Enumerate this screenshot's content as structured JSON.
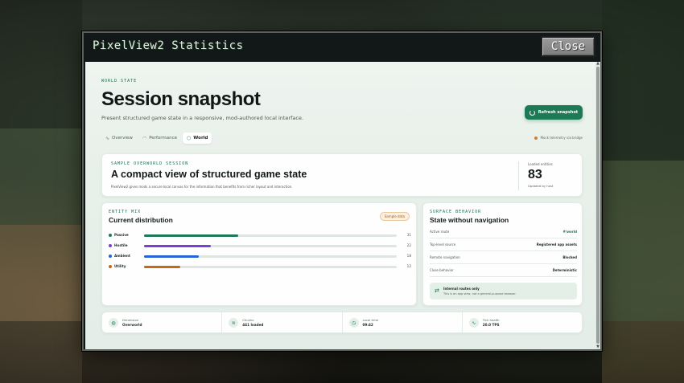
{
  "window": {
    "title": "PixelView2 Statistics",
    "close_label": "Close"
  },
  "header": {
    "eyebrow": "WORLD STATE",
    "title": "Session snapshot",
    "subtitle": "Present structured game state in a responsive, mod-authored local interface.",
    "refresh_label": "Refresh snapshot"
  },
  "tabs": [
    {
      "label": "Overview",
      "icon": "activity-icon"
    },
    {
      "label": "Performance",
      "icon": "gauge-icon"
    },
    {
      "label": "World",
      "icon": "cube-icon",
      "active": true
    }
  ],
  "telemetry_note": "Mock telemetry via bridge",
  "overview": {
    "eyebrow": "SAMPLE OVERWORLD SESSION",
    "title": "A compact view of structured game state",
    "description": "PixelView2 gives mods a secure local canvas for the information that benefits from richer layout and interaction.",
    "stat_label": "Loaded entities",
    "stat_value": "83",
    "stat_sub": "Updated by host"
  },
  "entity_mix": {
    "eyebrow": "ENTITY MIX",
    "title": "Current distribution",
    "badge": "Sample data",
    "rows": [
      {
        "label": "Passive",
        "value": 31,
        "max": 83,
        "color": "#1e7a56"
      },
      {
        "label": "Hostile",
        "value": 22,
        "max": 83,
        "color": "#7b3fd6"
      },
      {
        "label": "Ambient",
        "value": 18,
        "max": 83,
        "color": "#2563d6"
      },
      {
        "label": "Utility",
        "value": 12,
        "max": 83,
        "color": "#c2691a"
      }
    ]
  },
  "surface": {
    "eyebrow": "SURFACE BEHAVIOR",
    "title": "State without navigation",
    "rows": [
      {
        "key": "Active route",
        "value": "#/world",
        "accent": true
      },
      {
        "key": "Top-level source",
        "value": "Registered app assets"
      },
      {
        "key": "Remote navigation",
        "value": "Blocked"
      },
      {
        "key": "Close behavior",
        "value": "Deterministic"
      }
    ],
    "internal_title": "Internal routes only",
    "internal_sub": "This is an app view, not a general-purpose browser."
  },
  "footer": [
    {
      "key": "Dimension",
      "value": "Overworld",
      "icon": "globe-icon"
    },
    {
      "key": "Chunks",
      "value": "441 loaded",
      "icon": "layers-icon"
    },
    {
      "key": "Local time",
      "value": "09:42",
      "icon": "clock-icon"
    },
    {
      "key": "Tick health",
      "value": "20.0 TPS",
      "icon": "pulse-icon"
    }
  ]
}
